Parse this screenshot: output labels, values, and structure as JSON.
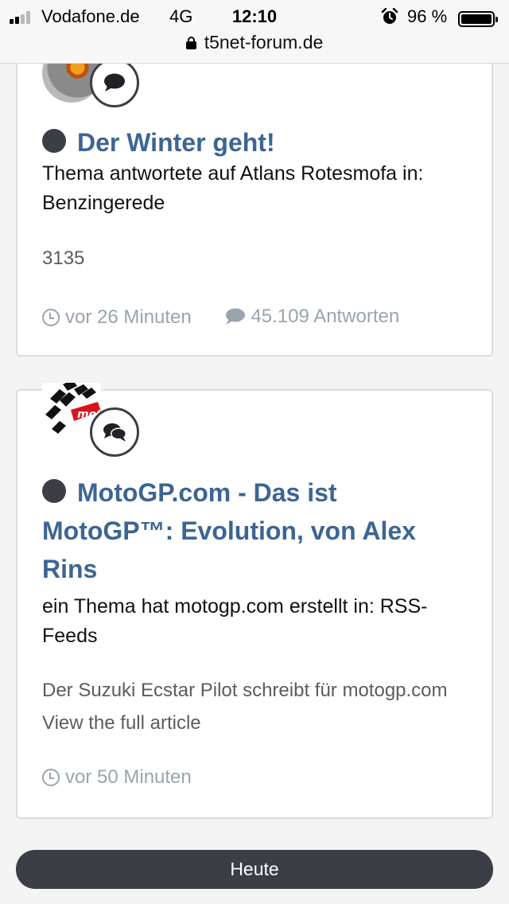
{
  "status_bar": {
    "carrier": "Vodafone.de",
    "network": "4G",
    "time": "12:10",
    "battery": "96 %",
    "battery_level": 0.96,
    "url": "t5net-forum.de"
  },
  "activities": [
    {
      "title": "Der Winter geht!",
      "meta": "Thema antwortete auf Atlans Rotesmofa in: Benzingerede",
      "snippet": "3135",
      "time": "vor 26 Minuten",
      "replies": "45.109 Antworten"
    },
    {
      "title": "MotoGP.com - Das ist MotoGP™: Evolution, von Alex Rins",
      "meta": "ein Thema hat motogp.com erstellt in: RSS-Feeds",
      "snippet": "Der Suzuki Ecstar Pilot schreibt für motogp.com View the full article",
      "time": "vor 50 Minuten"
    }
  ],
  "footer": {
    "today_label": "Heute"
  },
  "colors": {
    "link": "#3d6594",
    "muted": "#9aa4ae",
    "dark": "#3b3f45"
  }
}
